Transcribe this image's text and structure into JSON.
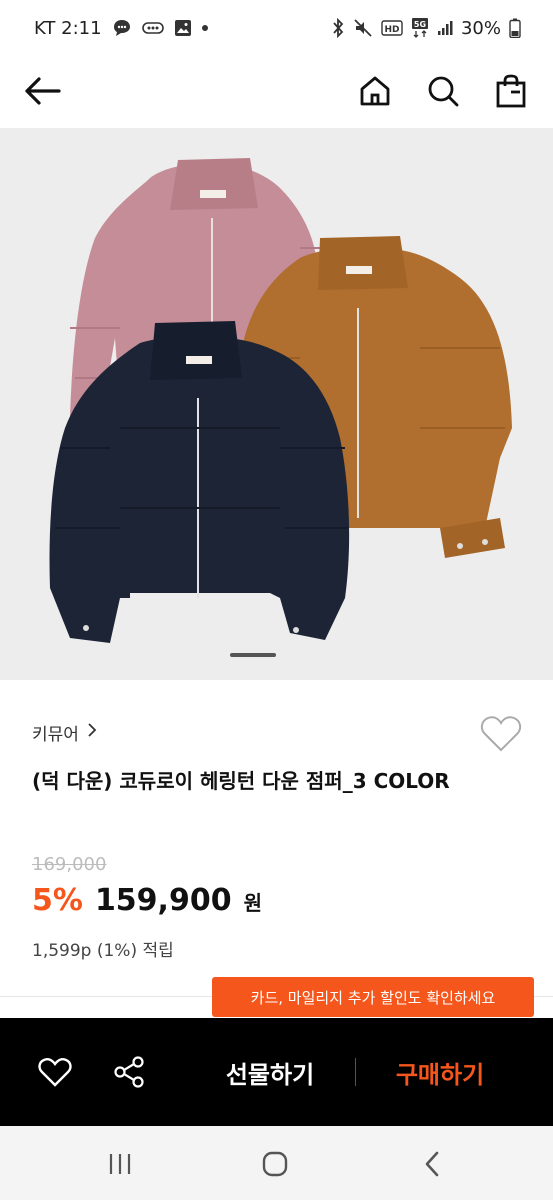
{
  "status_bar": {
    "carrier_time": "KT 2:11",
    "battery": "30%",
    "icons": [
      "chat-icon",
      "app-badge-icon",
      "gallery-icon",
      "bluetooth-icon",
      "mute-icon",
      "hd-icon",
      "5g-icon",
      "signal-icon",
      "battery-icon"
    ]
  },
  "nav": {
    "icons": [
      "back-arrow-icon",
      "home-icon",
      "search-icon",
      "shopping-bag-icon"
    ]
  },
  "product": {
    "brand": "키뮤어",
    "title": "(덕 다운) 코듀로이 헤링턴 다운 점퍼_3 COLOR",
    "original_price": "169,000",
    "discount": "5%",
    "price": "159,900",
    "currency": "원",
    "points": "1,599p (1%) 적립",
    "image_colors": [
      "#c48d97",
      "#b06e2f",
      "#1c2436"
    ]
  },
  "promo": {
    "text": "카드, 마일리지 추가 할인도 확인하세요"
  },
  "actions": {
    "gift_label": "선물하기",
    "buy_label": "구매하기"
  },
  "colors": {
    "accent": "#f4561c",
    "action_bar": "#000000"
  }
}
